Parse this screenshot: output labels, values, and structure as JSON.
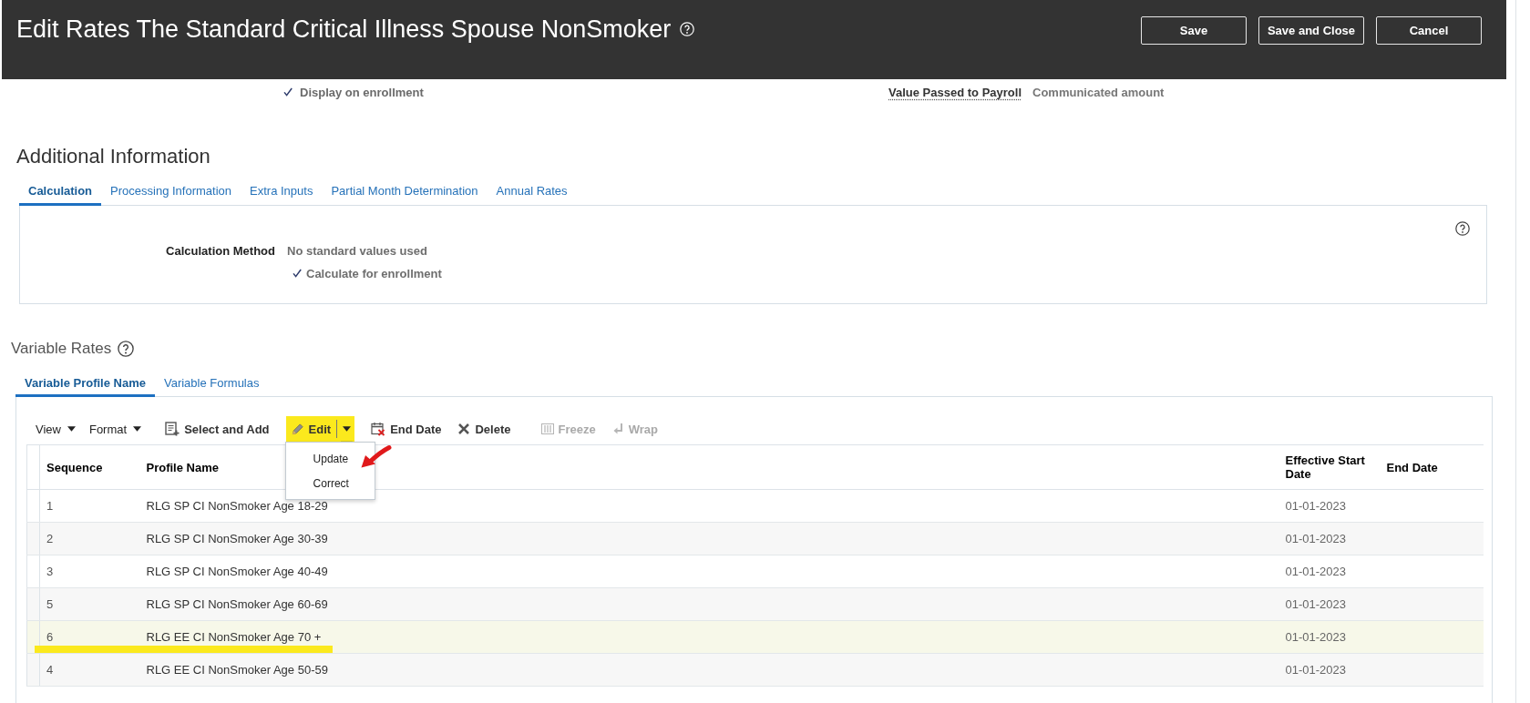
{
  "header": {
    "title": "Edit Rates The Standard Critical Illness Spouse NonSmoker",
    "buttons": [
      "Save",
      "Save and Close",
      "Cancel"
    ]
  },
  "summary": {
    "display_on_enrollment": {
      "label": "Display on enrollment",
      "checked": true
    },
    "value_passed_to_payroll": {
      "label": "Value Passed to Payroll",
      "value": "Communicated amount"
    }
  },
  "additional_information": {
    "title": "Additional Information",
    "tabs": [
      {
        "label": "Calculation",
        "selected": true
      },
      {
        "label": "Processing Information",
        "selected": false
      },
      {
        "label": "Extra Inputs",
        "selected": false
      },
      {
        "label": "Partial Month Determination",
        "selected": false
      },
      {
        "label": "Annual Rates",
        "selected": false
      }
    ],
    "calculation_method": {
      "label": "Calculation Method",
      "value": "No standard values used"
    },
    "calculate_for_enrollment": {
      "label": "Calculate for enrollment",
      "checked": true
    }
  },
  "variable_rates": {
    "title": "Variable Rates",
    "tabs": [
      {
        "label": "Variable Profile Name",
        "selected": true
      },
      {
        "label": "Variable Formulas",
        "selected": false
      }
    ],
    "toolbar": [
      {
        "items": [
          {
            "label": "View",
            "kind": "menu",
            "disabled": false,
            "highlighted": false
          },
          {
            "label": "Format",
            "kind": "menu",
            "disabled": false,
            "highlighted": false
          }
        ]
      },
      {
        "items": [
          {
            "label": "Select and Add",
            "kind": "add",
            "disabled": false,
            "highlighted": false
          },
          {
            "label": "Edit",
            "kind": "edit",
            "disabled": false,
            "highlighted": true,
            "expanded": true,
            "menu": [
              {
                "label": "Update",
                "arrow_mark": true
              },
              {
                "label": "Correct",
                "arrow_mark": false
              }
            ]
          },
          {
            "label": "End Date",
            "kind": "enddate",
            "disabled": false,
            "highlighted": false
          },
          {
            "label": "Delete",
            "kind": "delete",
            "disabled": false,
            "highlighted": false
          }
        ]
      },
      {
        "items": [
          {
            "label": "Freeze",
            "kind": "freeze",
            "disabled": true,
            "highlighted": false
          },
          {
            "label": "Wrap",
            "kind": "wrap",
            "disabled": true,
            "highlighted": false
          }
        ]
      }
    ],
    "table": {
      "columns": [
        "Sequence",
        "Profile Name",
        "Effective Start Date",
        "End Date"
      ],
      "rows": [
        {
          "sequence": "1",
          "profile_name": "RLG SP CI NonSmoker Age 18-29",
          "effective_start_date": "01-01-2023",
          "selected": false,
          "underlined": false
        },
        {
          "sequence": "2",
          "profile_name": "RLG SP CI NonSmoker Age 30-39",
          "effective_start_date": "01-01-2023",
          "selected": false,
          "underlined": false
        },
        {
          "sequence": "3",
          "profile_name": "RLG SP CI NonSmoker Age 40-49",
          "effective_start_date": "01-01-2023",
          "selected": false,
          "underlined": false
        },
        {
          "sequence": "5",
          "profile_name": "RLG SP CI NonSmoker Age 60-69",
          "effective_start_date": "01-01-2023",
          "selected": false,
          "underlined": false
        },
        {
          "sequence": "6",
          "profile_name": "RLG EE CI NonSmoker Age 70 +",
          "effective_start_date": "01-01-2023",
          "selected": true,
          "underlined": true
        },
        {
          "sequence": "4",
          "profile_name": "RLG EE CI NonSmoker Age 50-59",
          "effective_start_date": "01-01-2023",
          "selected": false,
          "underlined": false
        }
      ]
    }
  }
}
